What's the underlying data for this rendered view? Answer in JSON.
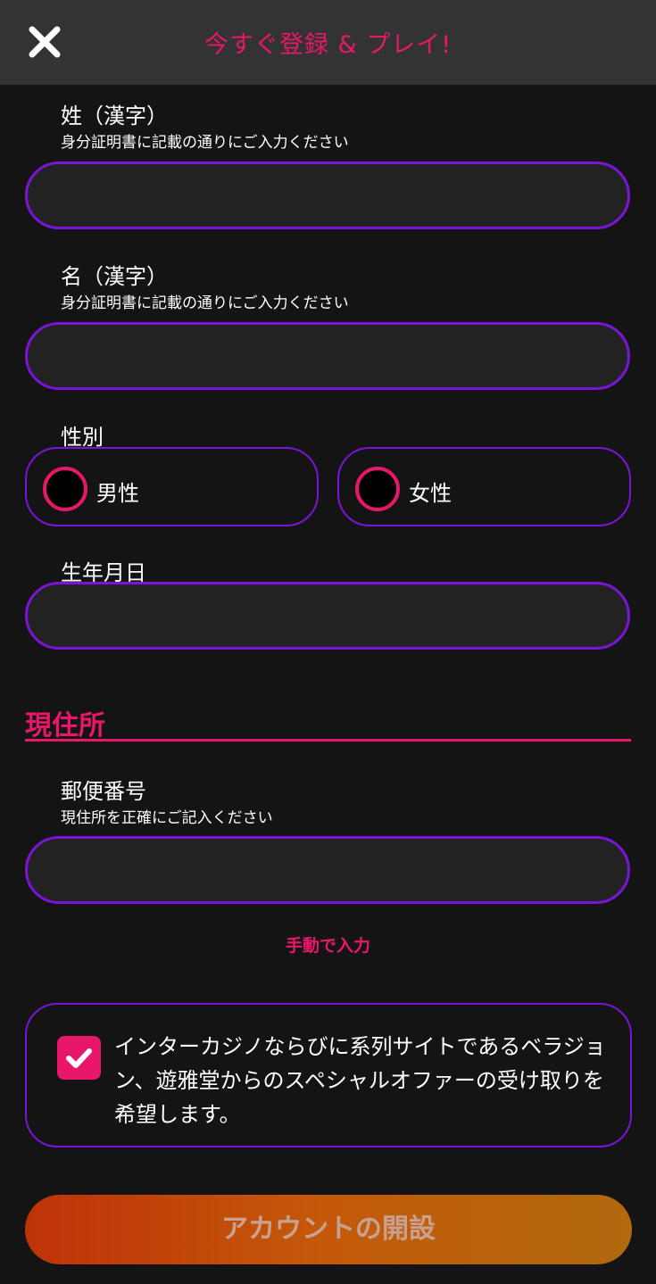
{
  "header": {
    "title": "今すぐ登録 & プレイ!",
    "close_icon": "close-icon"
  },
  "form": {
    "last_name": {
      "label": "姓（漢字）",
      "hint": "身分証明書に記載の通りにご入力ください",
      "value": ""
    },
    "first_name": {
      "label": "名（漢字）",
      "hint": "身分証明書に記載の通りにご入力ください",
      "value": ""
    },
    "gender": {
      "label": "性別",
      "options": [
        "男性",
        "女性"
      ],
      "selected": null
    },
    "birthdate": {
      "label": "生年月日",
      "value": ""
    }
  },
  "address": {
    "section_title": "現住所",
    "postal_code": {
      "label": "郵便番号",
      "hint": "現住所を正確にご記入ください",
      "value": ""
    },
    "manual_entry_link": "手動で入力"
  },
  "consent": {
    "checked": true,
    "text": "インターカジノならびに系列サイトであるベラジョン、遊雅堂からのスペシャルオファーの受け取りを希望します。"
  },
  "submit_label": "アカウントの開設",
  "colors": {
    "accent_pink": "#e8176a",
    "accent_purple": "#7a14d6",
    "background": "#151415",
    "header_bg": "#333333"
  }
}
